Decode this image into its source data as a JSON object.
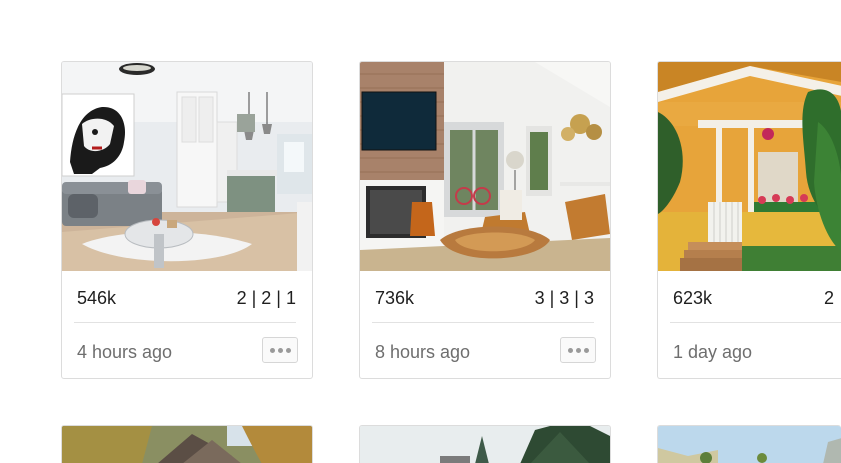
{
  "listings": [
    {
      "price": "546k",
      "specs": "2 | 2 | 1",
      "time": "4 hours ago",
      "image": "modern-kitchen-living-room-photo"
    },
    {
      "price": "736k",
      "specs": "3 | 3 | 3",
      "time": "8 hours ago",
      "image": "living-room-fireplace-photo"
    },
    {
      "price": "623k",
      "specs": "2",
      "time": "1 day ago",
      "image": "orange-house-exterior-photo"
    }
  ],
  "more_icon": "ellipsis-icon",
  "colors": {
    "card_border": "#dcdcdc",
    "divider": "#e2e2e2",
    "muted_text": "#6e6e6e",
    "more_button_bg": "#fafafa"
  }
}
